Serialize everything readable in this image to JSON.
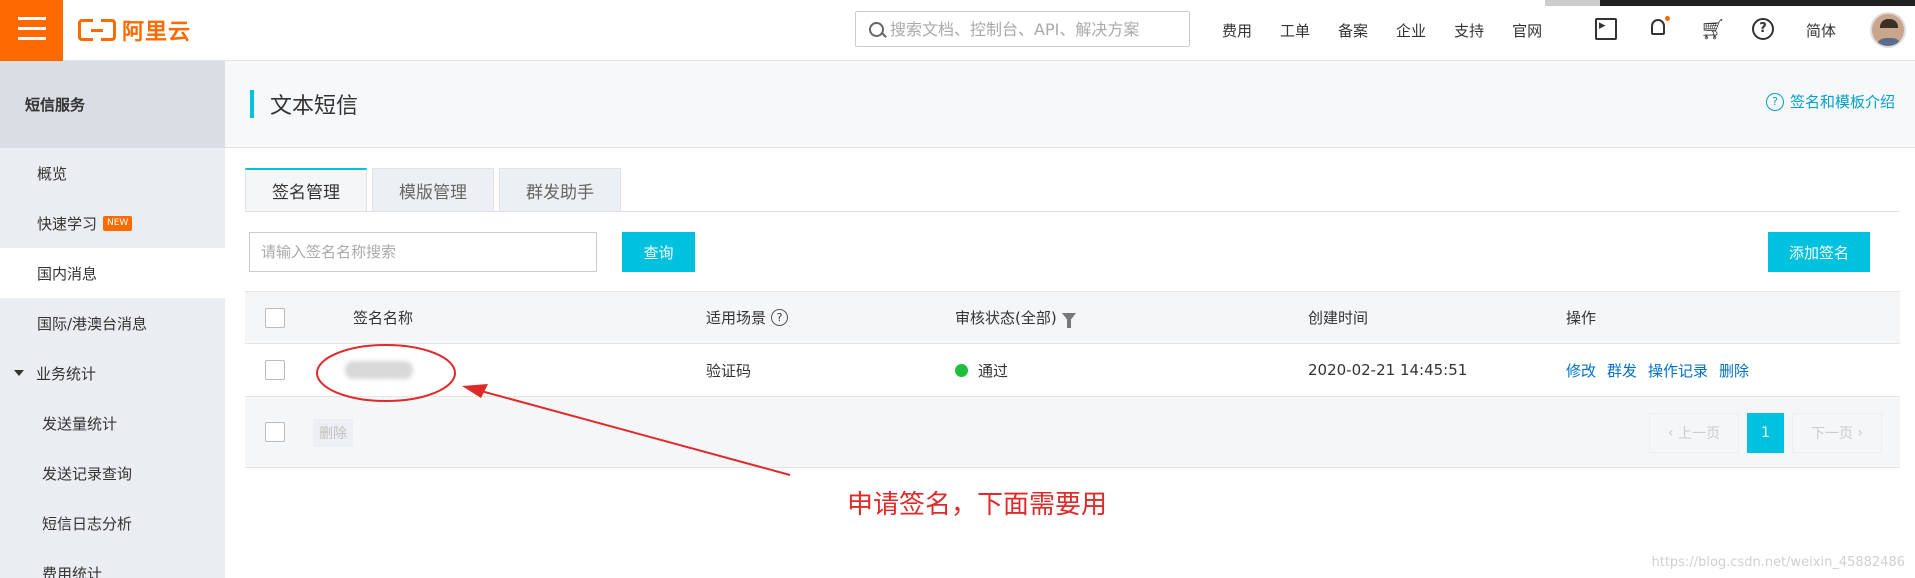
{
  "topbar": {
    "logo_text": "阿里云",
    "search_placeholder": "搜索文档、控制台、API、解决方案",
    "nav": [
      "费用",
      "工单",
      "备案",
      "企业",
      "支持",
      "官网"
    ],
    "lang": "简体",
    "icons": [
      "menu-icon",
      "terminal-icon",
      "bell-icon",
      "cart-icon",
      "help-icon"
    ]
  },
  "sidebar": {
    "header": "短信服务",
    "items": [
      {
        "label": "概览"
      },
      {
        "label": "快速学习",
        "badge": "NEW"
      },
      {
        "label": "国内消息"
      },
      {
        "label": "国际/港澳台消息"
      },
      {
        "label": "业务统计"
      },
      {
        "label": "发送量统计"
      },
      {
        "label": "发送记录查询"
      },
      {
        "label": "短信日志分析"
      },
      {
        "label": "费用统计"
      }
    ]
  },
  "main": {
    "title": "文本短信",
    "help_link": "签名和模板介绍",
    "tabs": [
      {
        "label": "签名管理"
      },
      {
        "label": "模版管理"
      },
      {
        "label": "群发助手"
      }
    ],
    "search_placeholder": "请输入签名名称搜索",
    "query_button": "查询",
    "add_button": "添加签名",
    "table": {
      "headers": [
        "签名名称",
        "适用场景",
        "审核状态(全部)",
        "创建时间",
        "操作"
      ],
      "rows": [
        {
          "scene": "验证码",
          "status": "通过",
          "created": "2020-02-21 14:45:51",
          "ops": [
            "修改",
            "群发",
            "操作记录",
            "删除"
          ]
        }
      ]
    },
    "footer": {
      "delete_button": "删除",
      "prev": "上一页",
      "page": "1",
      "next": "下一页"
    }
  },
  "annotation": "申请签名，下面需要用",
  "watermark": "https://blog.csdn.net/weixin_45882486",
  "colors": {
    "brand": "#ff6a00",
    "accent": "#00c1de",
    "link": "#0070cc",
    "annotation": "#e02a2a",
    "status_ok": "#1fbf3a"
  }
}
